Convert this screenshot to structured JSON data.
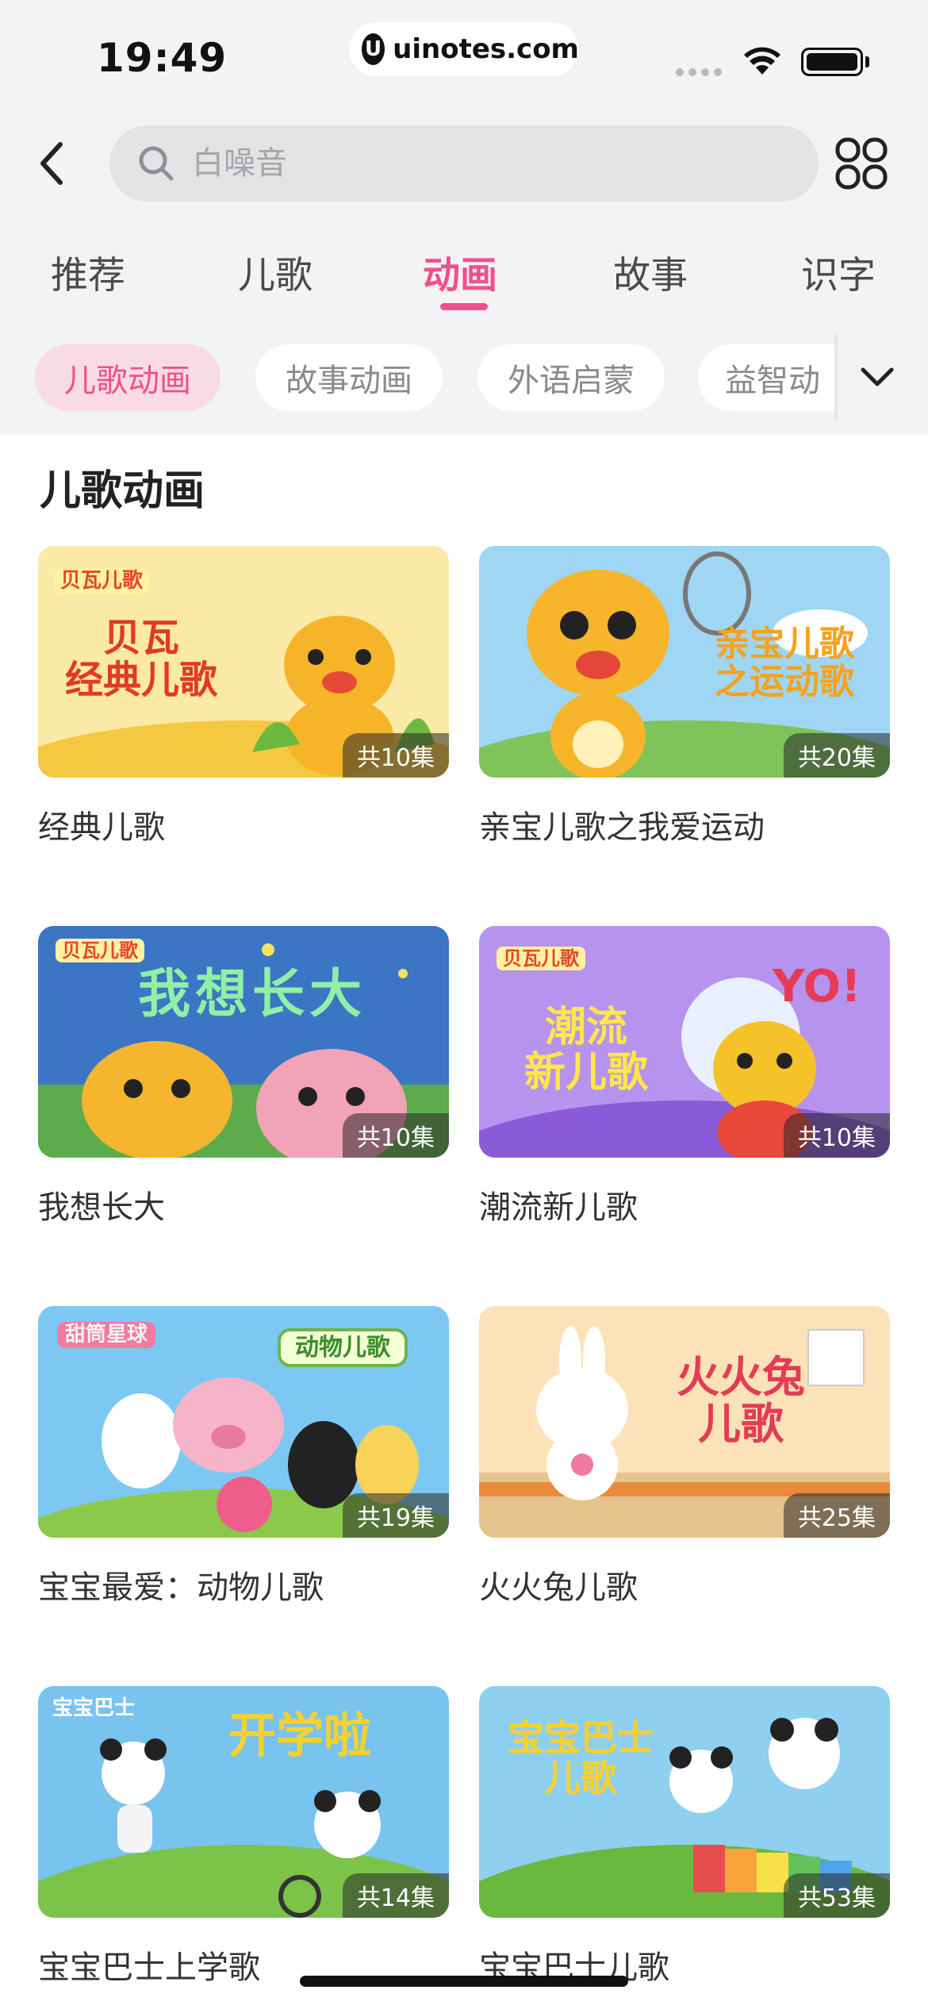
{
  "status_bar": {
    "time": "19:49",
    "url": "uinotes.com",
    "url_logo": "U"
  },
  "search": {
    "placeholder": "白噪音"
  },
  "tabs": [
    {
      "label": "推荐"
    },
    {
      "label": "儿歌"
    },
    {
      "label": "动画",
      "active": true
    },
    {
      "label": "故事"
    },
    {
      "label": "识字"
    }
  ],
  "chips": [
    {
      "label": "儿歌动画",
      "active": true
    },
    {
      "label": "故事动画"
    },
    {
      "label": "外语启蒙"
    },
    {
      "label": "益智动"
    }
  ],
  "section_title": "儿歌动画",
  "cards": [
    {
      "title": "经典儿歌",
      "count": "共10集",
      "thumb_text": "贝瓦\n经典儿歌",
      "brand": "贝瓦儿歌",
      "bg": "#fbe9a6"
    },
    {
      "title": "亲宝儿歌之我爱运动",
      "count": "共20集",
      "thumb_text": "亲宝儿歌\n之运动歌",
      "bg": "#9fd6f4"
    },
    {
      "title": "我想长大",
      "count": "共10集",
      "thumb_text": "我想长大",
      "brand": "贝瓦儿歌",
      "bg": "#3b75c4"
    },
    {
      "title": "潮流新儿歌",
      "count": "共10集",
      "thumb_text": "潮流\n新儿歌",
      "brand": "贝瓦儿歌",
      "bg": "#b693ee"
    },
    {
      "title": "宝宝最爱：动物儿歌",
      "count": "共19集",
      "thumb_text": "动物儿歌",
      "brand": "甜筒星球",
      "bg": "#7cc8f2"
    },
    {
      "title": "火火兔儿歌",
      "count": "共25集",
      "thumb_text": "火火兔\n儿歌",
      "bg": "#fbe2b8"
    },
    {
      "title": "宝宝巴士上学歌",
      "count": "共14集",
      "thumb_text": "开学啦",
      "brand": "宝宝巴士",
      "bg": "#79c3ef"
    },
    {
      "title": "宝宝巴士儿歌",
      "count": "共53集",
      "thumb_text": "宝宝巴士\n儿歌",
      "bg": "#8fd0f0"
    }
  ],
  "icons": {
    "back": "chevron-left-icon",
    "search": "search-icon",
    "grid": "grid-icon",
    "expand": "chevron-down-icon"
  },
  "colors": {
    "accent": "#f0508a",
    "chip_active_bg": "#f9dbe6",
    "top_bg": "#f3f2f4"
  }
}
